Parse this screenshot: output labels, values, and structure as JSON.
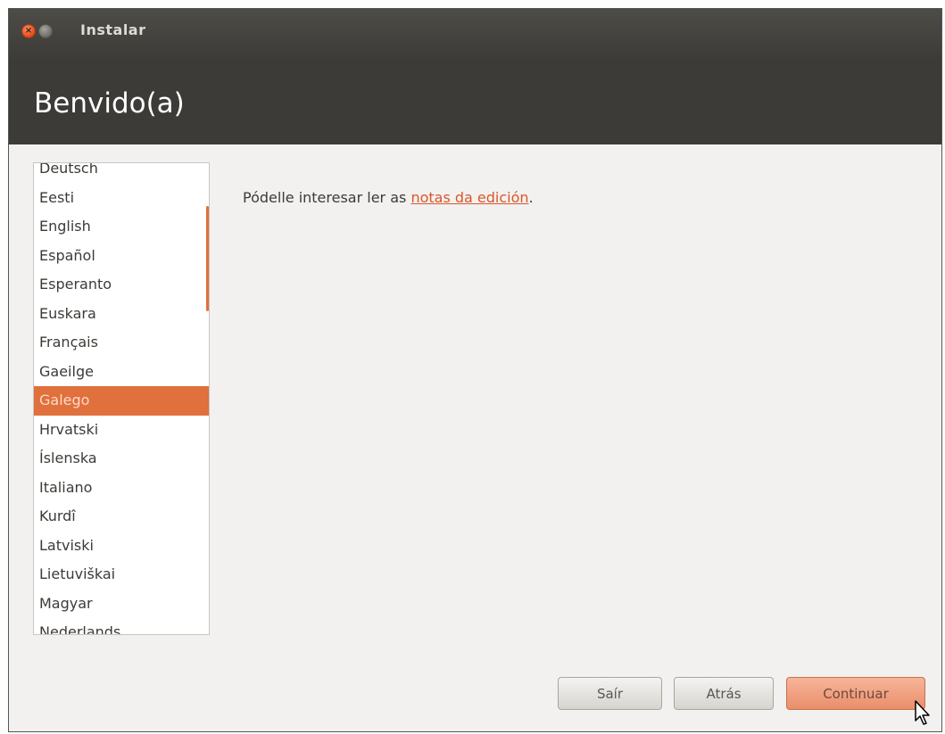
{
  "window": {
    "title": "Instalar",
    "close_glyph": "×"
  },
  "header": {
    "title": "Benvido(a)"
  },
  "languages": [
    "Deutsch",
    "Eesti",
    "English",
    "Español",
    "Esperanto",
    "Euskara",
    "Français",
    "Gaeilge",
    "Galego",
    "Hrvatski",
    "Íslenska",
    "Italiano",
    "Kurdî",
    "Latviski",
    "Lietuviškai",
    "Magyar",
    "Nederlands"
  ],
  "selected_language": "Galego",
  "notes": {
    "prefix": "Pódelle interesar ler as ",
    "link": "notas da edición",
    "suffix": "."
  },
  "buttons": {
    "quit": "Saír",
    "back": "Atrás",
    "continue": "Continuar"
  },
  "colors": {
    "accent": "#e0703c",
    "header_bg": "#3c3b37",
    "window_bg": "#f2f1f0"
  }
}
